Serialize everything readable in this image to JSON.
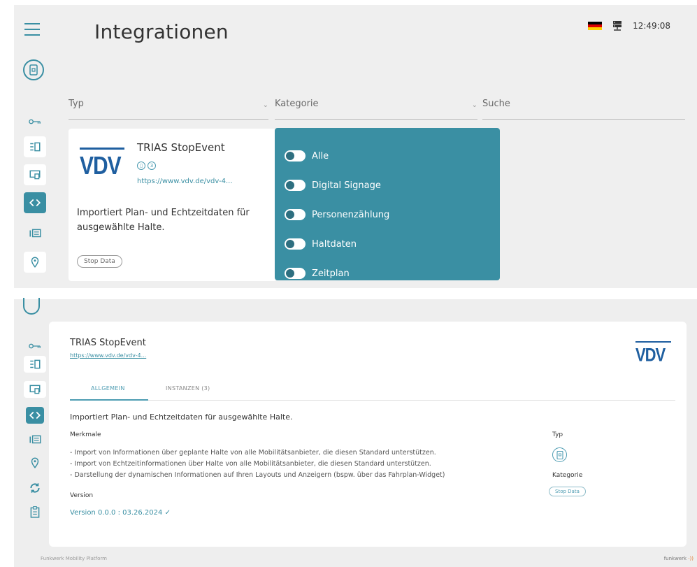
{
  "top": {
    "page_title": "Integrationen",
    "clock": "12:49:08",
    "flag_colors": [
      "#000000",
      "#dd0000",
      "#ffce00"
    ],
    "filters": {
      "typ": "Typ",
      "kategorie": "Kategorie",
      "suche": "Suche"
    },
    "card": {
      "logo": "VDV",
      "title": "TRIAS StopEvent",
      "icon_1": "stop-icon",
      "icon_2": "3",
      "link": "https://www.vdv.de/vdv-4...",
      "description": "Importiert Plan- und Echtzeitdaten für ausgewählte Halte.",
      "tag": "Stop Data"
    },
    "category_options": [
      {
        "label": "Alle"
      },
      {
        "label": "Digital Signage"
      },
      {
        "label": "Personenzählung"
      },
      {
        "label": "Haltdaten"
      },
      {
        "label": "Zeitplan"
      }
    ]
  },
  "detail": {
    "title": "TRIAS StopEvent",
    "link": "https://www.vdv.de/vdv-4...",
    "logo": "VDV",
    "tabs": [
      "ALLGEMEIN",
      "INSTANZEN (3)"
    ],
    "description": "Importiert Plan- und Echtzeitdaten für ausgewählte Halte.",
    "features_heading": "Merkmale",
    "features": [
      "- Import von Informationen über geplante Halte von alle Mobilitätsanbieter, die diesen Standard unterstützen.",
      "- Import von Echtzeitinformationen über Halte von alle Mobilitätsanbieter, die diesen Standard unterstützen.",
      "- Darstellung der dynamischen Informationen auf Ihren Layouts und Anzeigern (bspw. über das Fahrplan-Widget)"
    ],
    "version_heading": "Version",
    "version": "Version 0.0.0 : 03.26.2024",
    "side_typ": "Typ",
    "side_kategorie": "Kategorie",
    "side_tag": "Stop Data"
  },
  "footer": {
    "left": "Funkwerk Mobility Platform",
    "right": "funkwerk"
  },
  "colors": {
    "accent": "#3a8fa3",
    "vdv_blue": "#1f5fa0"
  }
}
